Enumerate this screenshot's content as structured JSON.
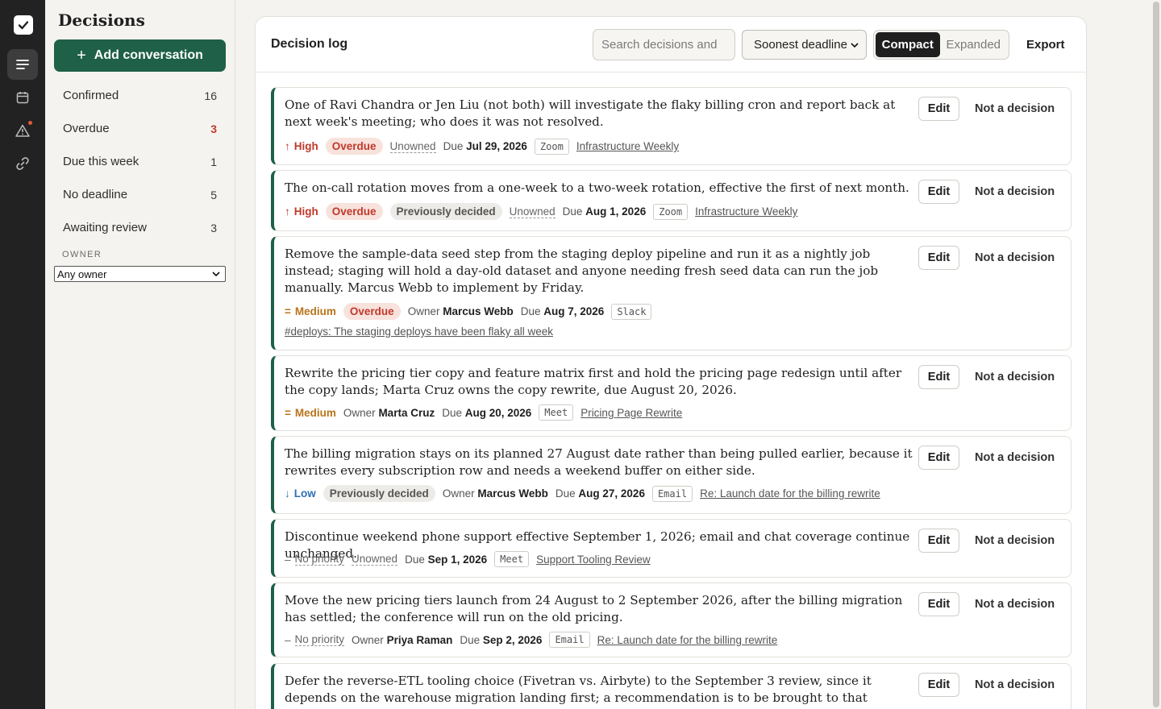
{
  "sidebar": {
    "title": "Decisions",
    "add_label": "Add conversation",
    "filters": [
      {
        "label": "Confirmed",
        "count": "16",
        "alert": false
      },
      {
        "label": "Overdue",
        "count": "3",
        "alert": true
      },
      {
        "label": "Due this week",
        "count": "1",
        "alert": false
      },
      {
        "label": "No deadline",
        "count": "5",
        "alert": false
      },
      {
        "label": "Awaiting review",
        "count": "3",
        "alert": false
      }
    ],
    "owner_label": "OWNER",
    "owner_value": "Any owner"
  },
  "header": {
    "title": "Decision log",
    "search_placeholder": "Search decisions and",
    "sort_value": "Soonest deadline",
    "view_compact": "Compact",
    "view_expanded": "Expanded",
    "export_label": "Export"
  },
  "actions": {
    "edit": "Edit",
    "not_decision": "Not a decision"
  },
  "labels": {
    "owner": "Owner",
    "due": "Due",
    "unowned": "Unowned"
  },
  "decisions": [
    {
      "text": "One of Ravi Chandra or Jen Liu (not both) will investigate the flaky billing cron and report back at next week's meeting; who does it was not resolved.",
      "priority": "High",
      "priority_level": "high",
      "overdue": "Overdue",
      "previously": "",
      "owner": "",
      "due": "Jul 29, 2026",
      "source": "Zoom",
      "link": "Infrastructure Weekly",
      "sublink": ""
    },
    {
      "text": "The on-call rotation moves from a one-week to a two-week rotation, effective the first of next month.",
      "priority": "High",
      "priority_level": "high",
      "overdue": "Overdue",
      "previously": "Previously decided",
      "owner": "",
      "due": "Aug 1, 2026",
      "source": "Zoom",
      "link": "Infrastructure Weekly",
      "sublink": ""
    },
    {
      "text": "Remove the sample-data seed step from the staging deploy pipeline and run it as a nightly job instead; staging will hold a day-old dataset and anyone needing fresh seed data can run the job manually. Marcus Webb to implement by Friday.",
      "priority": "Medium",
      "priority_level": "medium",
      "overdue": "Overdue",
      "previously": "",
      "owner": "Marcus Webb",
      "due": "Aug 7, 2026",
      "source": "Slack",
      "link": "",
      "sublink": "#deploys: The staging deploys have been flaky all week"
    },
    {
      "text": "Rewrite the pricing tier copy and feature matrix first and hold the pricing page redesign until after the copy lands; Marta Cruz owns the copy rewrite, due August 20, 2026.",
      "priority": "Medium",
      "priority_level": "medium",
      "overdue": "",
      "previously": "",
      "owner": "Marta Cruz",
      "due": "Aug 20, 2026",
      "source": "Meet",
      "link": "Pricing Page Rewrite",
      "sublink": ""
    },
    {
      "text": "The billing migration stays on its planned 27 August date rather than being pulled earlier, because it rewrites every subscription row and needs a weekend buffer on either side.",
      "priority": "Low",
      "priority_level": "low",
      "overdue": "",
      "previously": "Previously decided",
      "owner": "Marcus Webb",
      "due": "Aug 27, 2026",
      "source": "Email",
      "link": "Re: Launch date for the billing rewrite",
      "sublink": ""
    },
    {
      "text": "Discontinue weekend phone support effective September 1, 2026; email and chat coverage continue unchanged.",
      "priority": "No priority",
      "priority_level": "none",
      "overdue": "",
      "previously": "",
      "owner": "",
      "due": "Sep 1, 2026",
      "source": "Meet",
      "link": "Support Tooling Review",
      "sublink": ""
    },
    {
      "text": "Move the new pricing tiers launch from 24 August to 2 September 2026, after the billing migration has settled; the conference will run on the old pricing.",
      "priority": "No priority",
      "priority_level": "none",
      "overdue": "",
      "previously": "",
      "owner": "Priya Raman",
      "due": "Sep 2, 2026",
      "source": "Email",
      "link": "Re: Launch date for the billing rewrite",
      "sublink": ""
    },
    {
      "text": "Defer the reverse-ETL tooling choice (Fivetran vs. Airbyte) to the September 3 review, since it depends on the warehouse migration landing first; a recommendation is to be brought to that review.",
      "priority": "",
      "priority_level": "none",
      "overdue": "",
      "previously": "",
      "owner": "",
      "due": "",
      "source": "",
      "link": "",
      "sublink": ""
    }
  ]
}
